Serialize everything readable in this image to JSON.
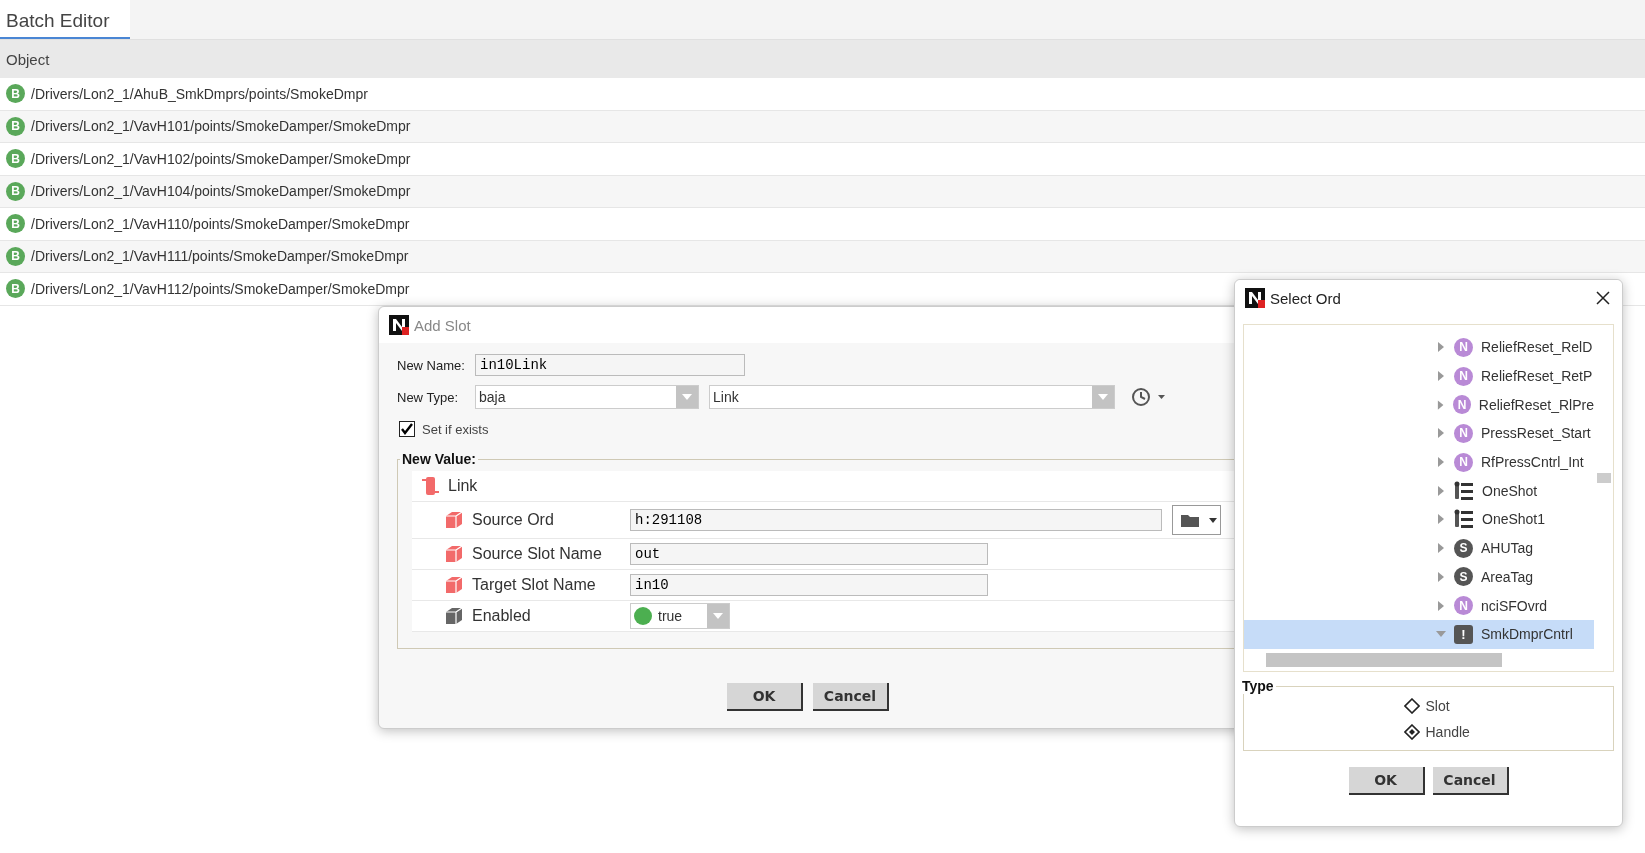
{
  "tab": {
    "label": "Batch Editor",
    "selected": true
  },
  "table": {
    "columns": [
      "Object"
    ],
    "rows": [
      {
        "badge": "B",
        "path": "/Drivers/Lon2_1/AhuB_SmkDmprs/points/SmokeDmpr"
      },
      {
        "badge": "B",
        "path": "/Drivers/Lon2_1/VavH101/points/SmokeDamper/SmokeDmpr"
      },
      {
        "badge": "B",
        "path": "/Drivers/Lon2_1/VavH102/points/SmokeDamper/SmokeDmpr"
      },
      {
        "badge": "B",
        "path": "/Drivers/Lon2_1/VavH104/points/SmokeDamper/SmokeDmpr"
      },
      {
        "badge": "B",
        "path": "/Drivers/Lon2_1/VavH110/points/SmokeDamper/SmokeDmpr"
      },
      {
        "badge": "B",
        "path": "/Drivers/Lon2_1/VavH111/points/SmokeDamper/SmokeDmpr"
      },
      {
        "badge": "B",
        "path": "/Drivers/Lon2_1/VavH112/points/SmokeDamper/SmokeDmpr"
      }
    ]
  },
  "add_slot": {
    "title": "Add Slot",
    "new_name_label": "New Name:",
    "new_name": "in10Link",
    "new_type_label": "New Type:",
    "module": "baja",
    "type": "Link",
    "set_if_exists": {
      "label": "Set if exists",
      "checked": true
    },
    "new_value_label": "New Value:",
    "link_label": "Link",
    "properties": [
      {
        "kind": "ord",
        "label": "Source Ord",
        "value": "h:291108"
      },
      {
        "kind": "text",
        "label": "Source Slot Name",
        "value": "out"
      },
      {
        "kind": "text",
        "label": "Target Slot Name",
        "value": "in10"
      },
      {
        "kind": "bool",
        "label": "Enabled",
        "value": "true",
        "on": true
      }
    ],
    "buttons": [
      "OK",
      "Cancel"
    ]
  },
  "select_ord": {
    "title": "Select Ord",
    "tree": [
      {
        "kind": "numeric",
        "badge": "N",
        "name": "ReliefReset_RelD",
        "expanded": false,
        "selected": false
      },
      {
        "kind": "numeric",
        "badge": "N",
        "name": "ReliefReset_RetP",
        "expanded": false,
        "selected": false
      },
      {
        "kind": "numeric",
        "badge": "N",
        "name": "ReliefReset_RlPre",
        "expanded": false,
        "selected": false
      },
      {
        "kind": "numeric",
        "badge": "N",
        "name": "PressReset_Start",
        "expanded": false,
        "selected": false
      },
      {
        "kind": "numeric",
        "badge": "N",
        "name": "RfPressCntrl_Int",
        "expanded": false,
        "selected": false
      },
      {
        "kind": "oneshot",
        "name": "OneShot",
        "expanded": false,
        "selected": false
      },
      {
        "kind": "oneshot",
        "name": "OneShot1",
        "expanded": false,
        "selected": false
      },
      {
        "kind": "string",
        "badge": "S",
        "name": "AHUTag",
        "expanded": false,
        "selected": false
      },
      {
        "kind": "string",
        "badge": "S",
        "name": "AreaTag",
        "expanded": false,
        "selected": false
      },
      {
        "kind": "numeric",
        "badge": "N",
        "name": "nciSFOvrd",
        "expanded": false,
        "selected": false
      },
      {
        "kind": "alarm",
        "badge": "!",
        "name": "SmkDmprCntrl",
        "expanded": true,
        "selected": true
      }
    ],
    "type_label": "Type",
    "type_options": [
      {
        "label": "Slot",
        "selected": false
      },
      {
        "label": "Handle",
        "selected": true
      }
    ],
    "buttons": [
      "OK",
      "Cancel"
    ]
  }
}
